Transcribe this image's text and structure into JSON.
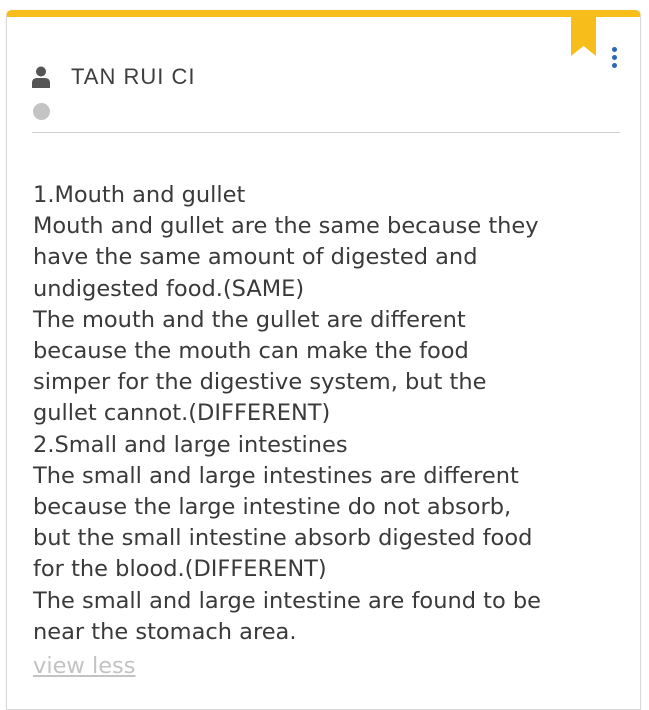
{
  "card": {
    "author": "TAN RUI CI",
    "content": "1.Mouth and gullet\nMouth and gullet are the same because they\nhave the same amount of digested and\nundigested food.(SAME)\nThe mouth and the gullet are different\nbecause the mouth can make the food\nsimper for the digestive system, but the\ngullet cannot.(DIFFERENT)\n2.Small and large intestines\nThe small and large intestines are different\nbecause the large intestine do not absorb,\nbut the small intestine absorb digested food\nfor the blood.(DIFFERENT)\nThe small and large intestine are found to be\nnear the stomach area.",
    "view_less_label": "view less"
  },
  "colors": {
    "accent": "#f6bd1b",
    "menu_icon": "#2b67b8",
    "status_dot": "#c4c4c4",
    "link_muted": "#c3c3c3"
  },
  "icons": {
    "bookmark": "bookmark-icon",
    "menu": "more-vertical-icon",
    "user": "user-icon"
  }
}
